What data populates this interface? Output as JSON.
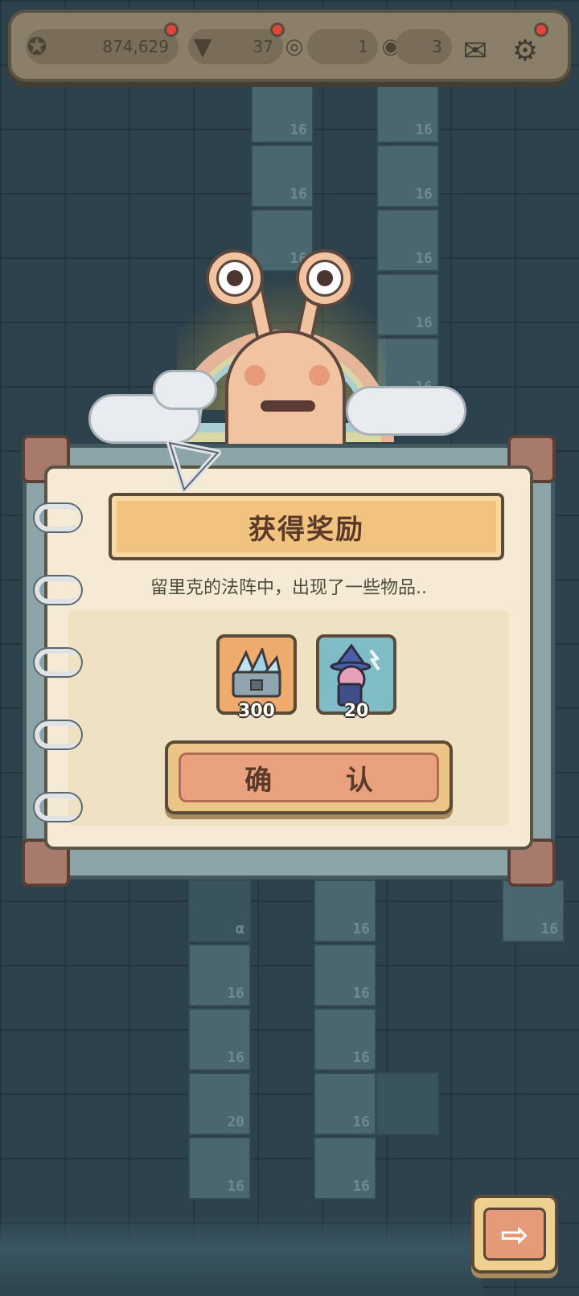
{
  "resources": {
    "stars": "874,629",
    "drill": "37",
    "coin_a": "1",
    "coin_b": "3"
  },
  "tiles": {
    "sixteen": "16",
    "twenty": "20",
    "alpha": "α"
  },
  "reward_dialog": {
    "title": "获得奖励",
    "subtitle": "留里克的法阵中，出现了一些物品..",
    "items": [
      {
        "icon": "crystal-chest-icon",
        "count": "300"
      },
      {
        "icon": "wizard-card-icon",
        "count": "20"
      }
    ],
    "confirm_label": "确 认"
  },
  "next_button_glyph": "⇨",
  "colors": {
    "accent": "#f2c37f",
    "button": "#e9a17f",
    "badge": "#e0443a"
  }
}
